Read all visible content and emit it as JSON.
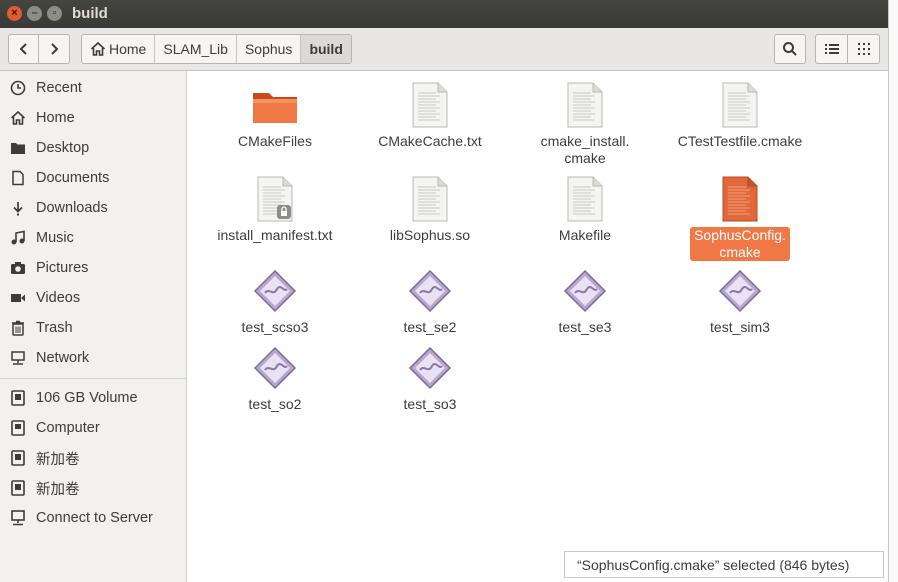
{
  "window": {
    "title": "build"
  },
  "breadcrumbs": [
    {
      "label": "Home",
      "icon": "home-icon"
    },
    {
      "label": "SLAM_Lib"
    },
    {
      "label": "Sophus"
    },
    {
      "label": "build",
      "active": true
    }
  ],
  "sidebar": {
    "places": [
      {
        "label": "Recent",
        "icon": "clock-icon"
      },
      {
        "label": "Home",
        "icon": "home-icon"
      },
      {
        "label": "Desktop",
        "icon": "folder-icon"
      },
      {
        "label": "Documents",
        "icon": "document-icon"
      },
      {
        "label": "Downloads",
        "icon": "download-icon"
      },
      {
        "label": "Music",
        "icon": "music-icon"
      },
      {
        "label": "Pictures",
        "icon": "camera-icon"
      },
      {
        "label": "Videos",
        "icon": "video-icon"
      },
      {
        "label": "Trash",
        "icon": "trash-icon"
      },
      {
        "label": "Network",
        "icon": "network-icon"
      }
    ],
    "devices": [
      {
        "label": "106 GB Volume",
        "icon": "drive-icon"
      },
      {
        "label": "Computer",
        "icon": "computer-icon"
      },
      {
        "label": "新加卷",
        "icon": "drive-icon"
      },
      {
        "label": "新加卷",
        "icon": "drive-icon"
      },
      {
        "label": "Connect to Server",
        "icon": "server-icon"
      }
    ]
  },
  "files": [
    {
      "name": "CMakeFiles",
      "type": "folder"
    },
    {
      "name": "CMakeCache.txt",
      "type": "text"
    },
    {
      "name": "cmake_install.\ncmake",
      "type": "text"
    },
    {
      "name": "CTestTestfile.cmake",
      "type": "text"
    },
    {
      "name": "install_manifest.txt",
      "type": "text-locked"
    },
    {
      "name": "libSophus.so",
      "type": "text"
    },
    {
      "name": "Makefile",
      "type": "text"
    },
    {
      "name": "SophusConfig.\ncmake",
      "type": "text",
      "selected": true
    },
    {
      "name": "test_scso3",
      "type": "executable"
    },
    {
      "name": "test_se2",
      "type": "executable"
    },
    {
      "name": "test_se3",
      "type": "executable"
    },
    {
      "name": "test_sim3",
      "type": "executable"
    },
    {
      "name": "test_so2",
      "type": "executable"
    },
    {
      "name": "test_so3",
      "type": "executable"
    }
  ],
  "status": {
    "text": "“SophusConfig.cmake” selected  (846 bytes)"
  },
  "colors": {
    "accent": "#f07746",
    "titlebar": "#3c3b37",
    "close": "#e25b32"
  }
}
